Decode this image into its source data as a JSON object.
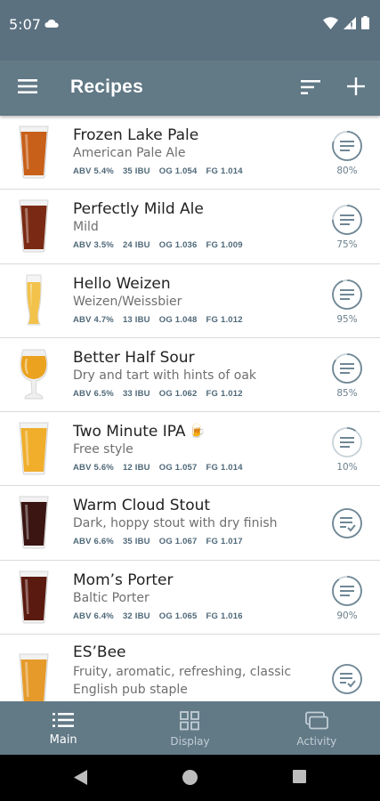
{
  "status_bar": {
    "time": "5:07"
  },
  "app_bar": {
    "title": "Recipes"
  },
  "recipes": [
    {
      "name": "Frozen Lake Pale",
      "style": "American Pale Ale",
      "abv": "ABV 5.4%",
      "ibu": "35 IBU",
      "og": "OG 1.054",
      "fg": "FG 1.014",
      "progress": "80%",
      "beer_color": "#c8601a",
      "glass": "pint",
      "status": "in-progress",
      "progress_value": 0.8
    },
    {
      "name": "Perfectly Mild Ale",
      "style": "Mild",
      "abv": "ABV 3.5%",
      "ibu": "24 IBU",
      "og": "OG 1.036",
      "fg": "FG 1.009",
      "progress": "75%",
      "beer_color": "#7a2a14",
      "glass": "pint",
      "status": "in-progress",
      "progress_value": 0.75
    },
    {
      "name": "Hello Weizen",
      "style": "Weizen/Weissbier",
      "abv": "ABV 4.7%",
      "ibu": "13 IBU",
      "og": "OG 1.048",
      "fg": "FG 1.012",
      "progress": "95%",
      "beer_color": "#f2c24a",
      "glass": "weizen",
      "status": "in-progress",
      "progress_value": 0.95
    },
    {
      "name": "Better Half Sour",
      "style": "Dry and tart with hints of oak",
      "abv": "ABV 6.5%",
      "ibu": "33 IBU",
      "og": "OG 1.062",
      "fg": "FG 1.012",
      "progress": "85%",
      "beer_color": "#eaa21f",
      "glass": "tulip",
      "status": "in-progress",
      "progress_value": 0.85
    },
    {
      "name": "Two Minute IPA",
      "style": "Free style",
      "abv": "ABV 5.6%",
      "ibu": "12 IBU",
      "og": "OG 1.057",
      "fg": "FG 1.014",
      "progress": "10%",
      "beer_color": "#f0ae2b",
      "glass": "pint",
      "status": "in-progress",
      "progress_value": 0.1,
      "emoji": "🍺"
    },
    {
      "name": "Warm Cloud Stout",
      "style": "Dark, hoppy stout with dry finish",
      "abv": "ABV 6.6%",
      "ibu": "35 IBU",
      "og": "OG 1.067",
      "fg": "FG 1.017",
      "progress": "",
      "beer_color": "#3a1512",
      "glass": "pint",
      "status": "done"
    },
    {
      "name": "Mom’s Porter",
      "style": "Baltic Porter",
      "abv": "ABV 6.4%",
      "ibu": "32 IBU",
      "og": "OG 1.065",
      "fg": "FG 1.016",
      "progress": "90%",
      "beer_color": "#5a1a10",
      "glass": "pint",
      "status": "in-progress",
      "progress_value": 0.9
    },
    {
      "name": "ES’Bee",
      "style": "Fruity, aromatic, refreshing, classic English pub staple",
      "abv": "",
      "ibu": "",
      "og": "",
      "fg": "",
      "progress": "",
      "beer_color": "#e59a2a",
      "glass": "pint",
      "status": "done"
    }
  ],
  "bottom_nav": [
    {
      "label": "Main",
      "icon": "list-icon",
      "active": true
    },
    {
      "label": "Display",
      "icon": "grid-icon",
      "active": false
    },
    {
      "label": "Activity",
      "icon": "windows-icon",
      "active": false
    }
  ],
  "colors": {
    "app_bar": "#627986",
    "status_bar": "#5b7180",
    "stats_text": "#4e6878",
    "icon_ring": "#6f8795"
  }
}
